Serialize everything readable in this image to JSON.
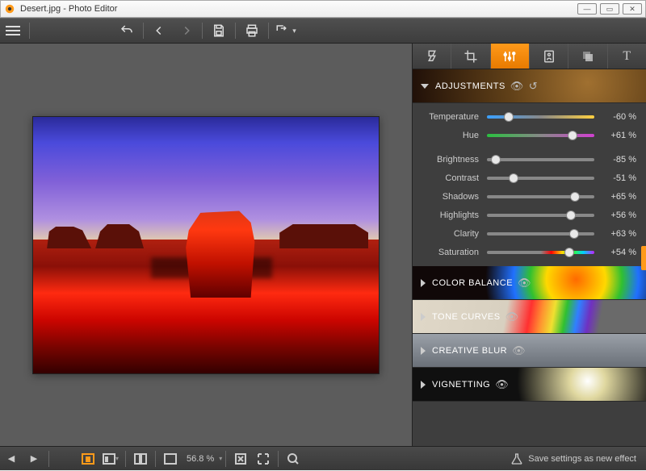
{
  "titlebar": {
    "title": "Desert.jpg - Photo Editor"
  },
  "toolbar": {
    "icons": [
      "menu",
      "undo",
      "back",
      "forward",
      "save",
      "print",
      "export"
    ]
  },
  "panel": {
    "sections": {
      "adjustments": {
        "label": "ADJUSTMENTS"
      },
      "color_balance": {
        "label": "COLOR BALANCE"
      },
      "tone_curves": {
        "label": "TONE CURVES"
      },
      "creative_blur": {
        "label": "CREATIVE BLUR"
      },
      "vignetting": {
        "label": "VIGNETTING"
      }
    },
    "sliders": {
      "temperature": {
        "label": "Temperature",
        "value": "-60 %",
        "pos": 20
      },
      "hue": {
        "label": "Hue",
        "value": "+61 %",
        "pos": 80
      },
      "brightness": {
        "label": "Brightness",
        "value": "-85 %",
        "pos": 8
      },
      "contrast": {
        "label": "Contrast",
        "value": "-51 %",
        "pos": 25
      },
      "shadows": {
        "label": "Shadows",
        "value": "+65 %",
        "pos": 82
      },
      "highlights": {
        "label": "Highlights",
        "value": "+56 %",
        "pos": 78
      },
      "clarity": {
        "label": "Clarity",
        "value": "+63 %",
        "pos": 81
      },
      "saturation": {
        "label": "Saturation",
        "value": "+54 %",
        "pos": 77
      }
    }
  },
  "bottombar": {
    "zoom": "56.8 %",
    "save_label": "Save settings as new effect"
  }
}
